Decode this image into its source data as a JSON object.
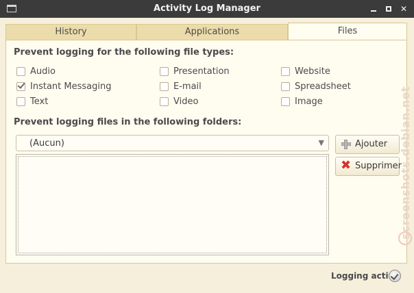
{
  "window": {
    "title": "Activity Log Manager",
    "minimize_icon": "minimize-icon",
    "maximize_icon": "maximize-icon",
    "close_icon": "close-icon"
  },
  "tabs": [
    {
      "label": "History",
      "active": false
    },
    {
      "label": "Applications",
      "active": false
    },
    {
      "label": "Files",
      "active": true
    }
  ],
  "file_types": {
    "heading": "Prevent logging for the following file types:",
    "items": [
      {
        "label": "Audio",
        "checked": false
      },
      {
        "label": "Instant Messaging",
        "checked": true
      },
      {
        "label": "Text",
        "checked": false
      },
      {
        "label": "Presentation",
        "checked": false
      },
      {
        "label": "E-mail",
        "checked": false
      },
      {
        "label": "Video",
        "checked": false
      },
      {
        "label": "Website",
        "checked": false
      },
      {
        "label": "Spreadsheet",
        "checked": false
      },
      {
        "label": "Image",
        "checked": false
      }
    ]
  },
  "folders": {
    "heading": "Prevent logging files in the following folders:",
    "combo_value": "(Aucun)",
    "add_label": "Ajouter",
    "add_icon": "plus-icon",
    "remove_label": "Supprimer",
    "remove_icon": "red-x-icon"
  },
  "status": {
    "text": "Logging active",
    "icon": "check-circle-icon"
  },
  "watermark": {
    "text": "screenshots.debian.net"
  },
  "colors": {
    "titlebar": "#3b3b3b",
    "window_bg": "#f5efdc",
    "tab_inactive": "#ecdcab",
    "panel_bg": "#fffcf0",
    "remove_icon": "#d8322a"
  }
}
